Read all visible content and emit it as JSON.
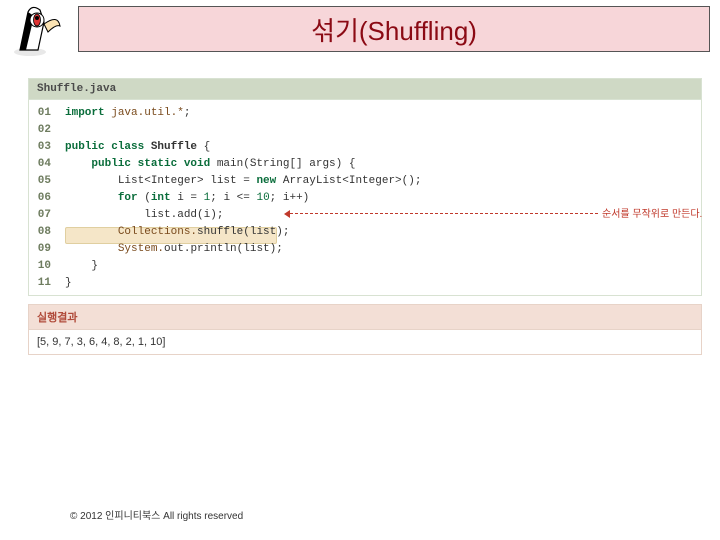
{
  "title": "섞기(Shuffling)",
  "file_label": "Shuffle.java",
  "line_numbers": [
    "01",
    "02",
    "03",
    "04",
    "05",
    "06",
    "07",
    "08",
    "09",
    "10",
    "11"
  ],
  "code": {
    "l1_kw": "import ",
    "l1_lib": "java.util.*",
    "l1_end": ";",
    "l3_kw": "public class ",
    "l3_cls": "Shuffle",
    "l3_end": " {",
    "l4_kw1": "public static void ",
    "l4_name": "main",
    "l4_sig": "(String[] args) {",
    "l5_a": "List<Integer> list = ",
    "l5_kw": "new ",
    "l5_b": "ArrayList<Integer>();",
    "l6_kw": "for ",
    "l6_a": "(",
    "l6_kw2": "int ",
    "l6_b": "i = ",
    "l6_n1": "1",
    "l6_c": "; i <= ",
    "l6_n2": "10",
    "l6_d": "; i++)",
    "l7": "list.add(i);",
    "l8_a": "Collections.",
    "l8_b": "shuffle",
    "l8_c": "(list);",
    "l9_a": "System.",
    "l9_b": "out",
    "l9_c": ".println(list);",
    "l10": "}",
    "l11": "}"
  },
  "annotation": "순서를 무작위로 만든다.",
  "result_label": "실행결과",
  "result_output": "[5, 9, 7, 3, 6, 4, 8, 2, 1, 10]",
  "footer": "© 2012 인피니티북스  All rights reserved"
}
